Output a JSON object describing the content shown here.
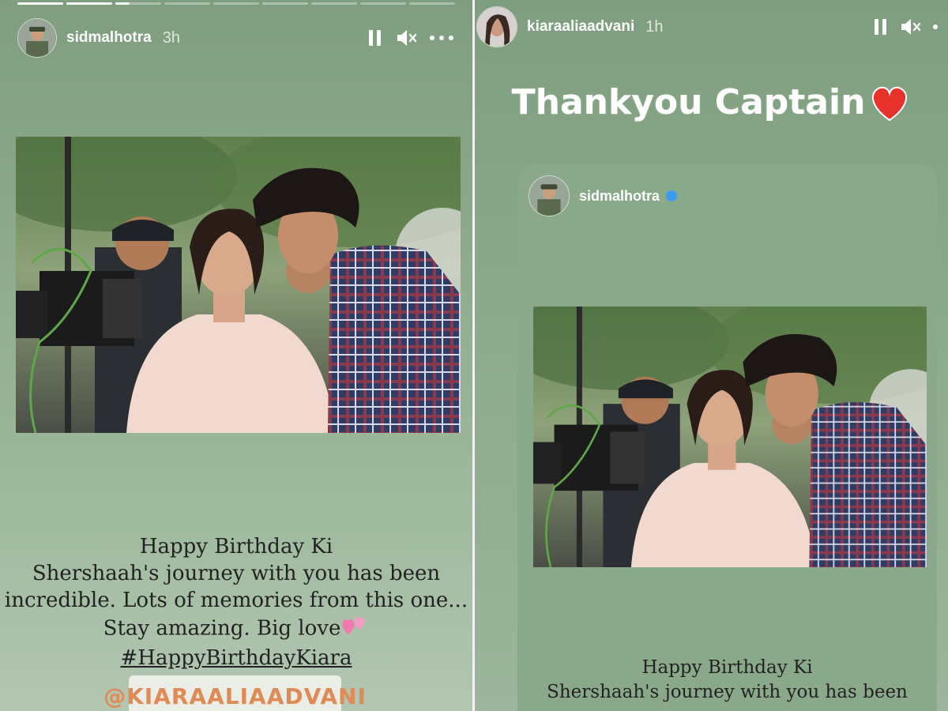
{
  "left_story": {
    "username": "sidmalhotra",
    "time": "3h",
    "progress": {
      "segments": 9,
      "completed": 2,
      "current_progress": 0.3
    },
    "caption": {
      "line1": "Happy Birthday Ki",
      "line2": "Shershaah's journey with you has been",
      "line3": "incredible. Lots of memories from this one...",
      "line4": "Stay amazing. Big love",
      "hashtag": "#HappyBirthdayKiara"
    },
    "mention": "@KIARAALIAADVANI"
  },
  "right_story": {
    "username": "kiaraaliaadvani",
    "time": "1h",
    "headline": "Thankyou Captain",
    "repost": {
      "username": "sidmalhotra",
      "verified": true,
      "caption": {
        "line1": "Happy Birthday Ki",
        "line2": "Shershaah's journey with you has been"
      }
    }
  },
  "icons": {
    "pause": "pause-icon",
    "mute": "speaker-muted-icon",
    "more": "more-horizontal-icon",
    "heart": "heart-icon",
    "two_hearts": "two-hearts-icon"
  },
  "colors": {
    "story_background": "#8aa98a",
    "mention_text": "#e08a55",
    "verified_badge": "#3b9bf0",
    "heart": "#e8322c",
    "two_hearts": "#f07ab0"
  }
}
